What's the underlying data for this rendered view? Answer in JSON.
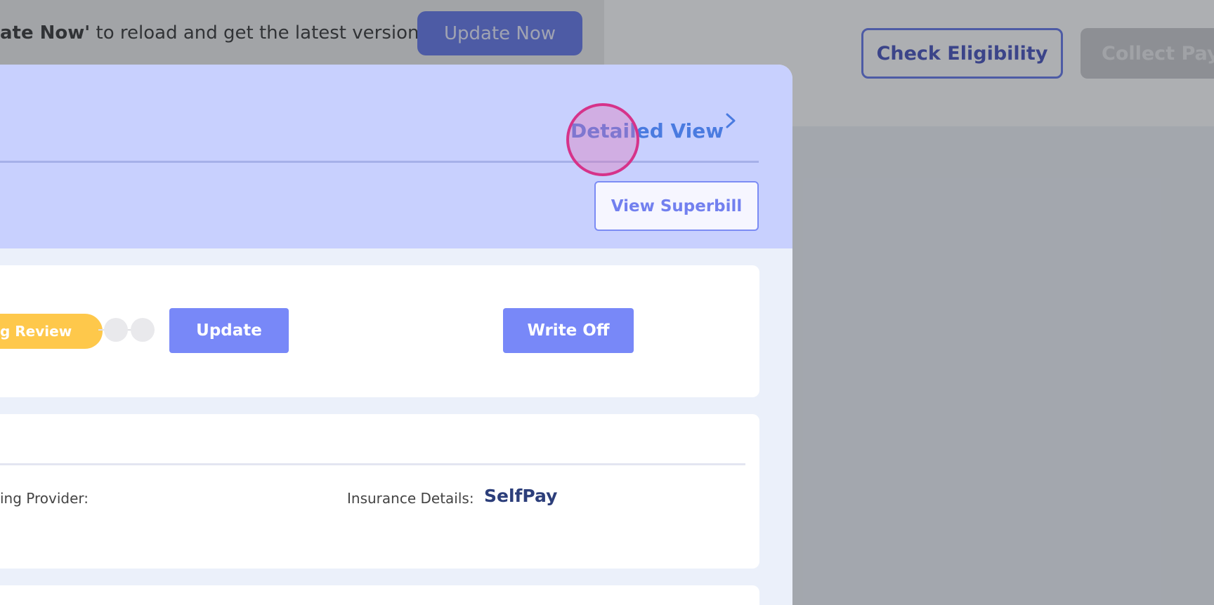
{
  "banner": {
    "message_bold": "ate Now'",
    "message_rest": " to reload and get the latest version.",
    "update_now_label": "Update Now"
  },
  "header": {
    "check_eligibility_label": "Check Eligibility",
    "collect_pay_label": "Collect Pay"
  },
  "drawer": {
    "detailed_view_label": "Detailed View",
    "view_superbill_label": "View Superbill",
    "status_label": "g Review",
    "update_label": "Update",
    "write_off_label": "Write Off",
    "provider_label": "ing Provider:",
    "insurance_label": "Insurance Details:",
    "insurance_value": "SelfPay"
  },
  "colors": {
    "accent": "#7888f8",
    "status_pending": "#fec84b",
    "link": "#4a7be0",
    "click_indicator": "#d6338a"
  }
}
